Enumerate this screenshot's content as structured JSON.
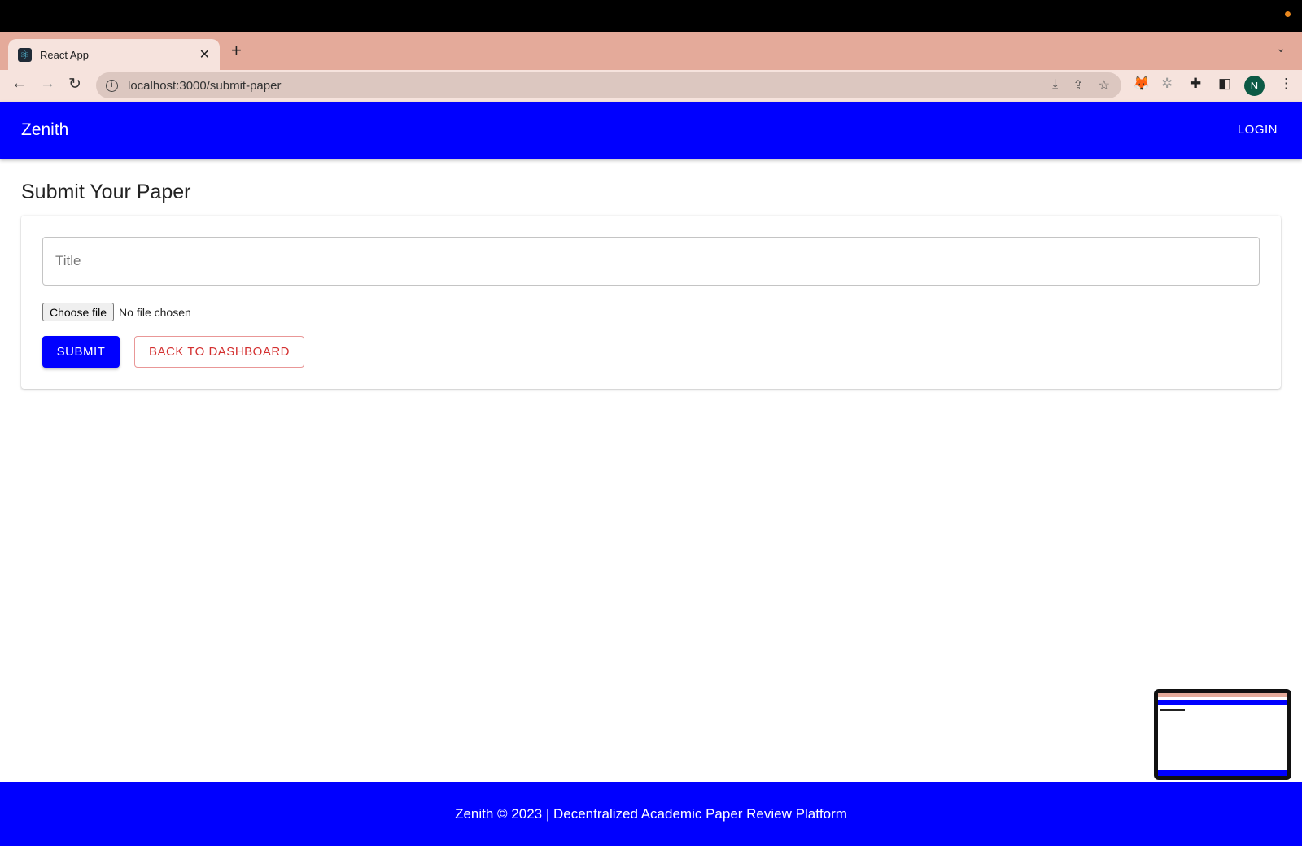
{
  "browser": {
    "tab_title": "React App",
    "url": "localhost:3000/submit-paper",
    "profile_initial": "N",
    "icons": [
      "react-favicon",
      "close-icon",
      "plus-icon",
      "chevron-down-icon",
      "back-icon",
      "forward-icon",
      "reload-icon",
      "info-icon",
      "install-icon",
      "share-icon",
      "star-icon",
      "metamask-icon",
      "extension-bug-icon",
      "puzzle-icon",
      "sidepanel-icon",
      "kebab-menu-icon"
    ]
  },
  "appbar": {
    "brand": "Zenith",
    "login_label": "LOGIN"
  },
  "main": {
    "page_title": "Submit Your Paper",
    "title_placeholder": "Title",
    "title_value": "",
    "file_button_label": "Choose file",
    "file_status": "No file chosen",
    "submit_label": "SUBMIT",
    "back_label": "BACK TO DASHBOARD"
  },
  "footer": {
    "text": "Zenith © 2023 | Decentralized Academic Paper Review Platform"
  },
  "colors": {
    "primary": "#0000ff",
    "error": "#d32f2f",
    "tabstrip": "#e4aa9a"
  }
}
